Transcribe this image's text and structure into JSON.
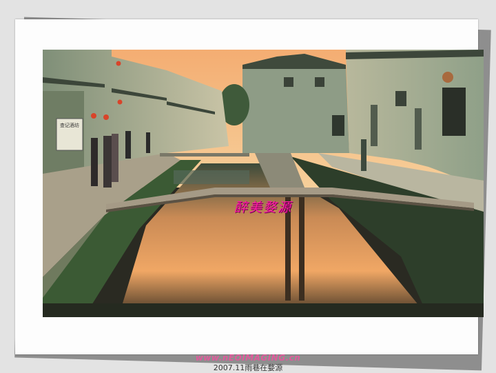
{
  "photo": {
    "overlay_text": "醉美婺源",
    "sign_text": "查记酒坊"
  },
  "footer": {
    "watermark": "www.nEOIMAGING.cn",
    "caption": "2007.11雨巷在婺源"
  },
  "colors": {
    "sky": "#f3b57a",
    "water": "#e89a5a",
    "walls": "#9aa88e",
    "overlay_text": "#ff1aa6"
  }
}
